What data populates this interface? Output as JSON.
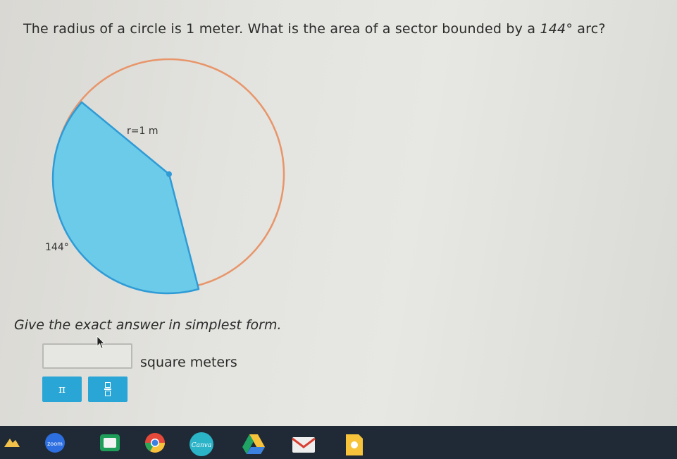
{
  "question": {
    "text_before": "The radius of a circle is 1 meter. What is the area of a sector bounded by a ",
    "angle": "144°",
    "text_after": " arc?"
  },
  "figure": {
    "radius_label": "r=1 m",
    "angle_label": "144°",
    "sector_color": "#6ccbe8",
    "circle_color": "#e8956a",
    "edge_color": "#2f9bd6"
  },
  "instruction": "Give the exact answer in simplest form.",
  "answer": {
    "value": "",
    "unit": "square meters"
  },
  "tools": {
    "pi_label": "π",
    "fraction_icon": "fraction-icon"
  },
  "taskbar": {
    "zoom_label": "zoom",
    "canva_label": "Canva",
    "icons": [
      "start-icon",
      "zoom-icon",
      "classroom-icon",
      "chrome-icon",
      "canva-icon",
      "drive-icon",
      "gmail-icon",
      "keep-icon"
    ]
  }
}
